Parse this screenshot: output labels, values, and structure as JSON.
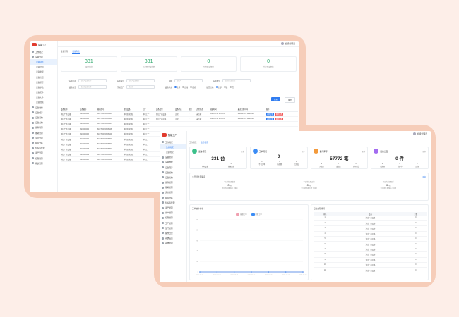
{
  "brand": "智能工厂",
  "user": "超级管理员",
  "window1": {
    "menu": [
      {
        "label": "工作概况",
        "type": "item"
      },
      {
        "label": "设备管理",
        "type": "item"
      },
      {
        "label": "设备列表",
        "type": "sub",
        "active": true
      },
      {
        "label": "设备分组",
        "type": "sub"
      },
      {
        "label": "设备类型",
        "type": "sub"
      },
      {
        "label": "设备位置",
        "type": "sub"
      },
      {
        "label": "设备型号",
        "type": "sub"
      },
      {
        "label": "设备参数",
        "type": "sub"
      },
      {
        "label": "设备配件",
        "type": "sub"
      },
      {
        "label": "设备文件",
        "type": "sub"
      },
      {
        "label": "设备档案",
        "type": "sub"
      },
      {
        "label": "设备维修",
        "type": "item"
      },
      {
        "label": "设备保养",
        "type": "item"
      },
      {
        "label": "设备巡检",
        "type": "item"
      },
      {
        "label": "设备点检",
        "type": "item"
      },
      {
        "label": "备件管理",
        "type": "item"
      },
      {
        "label": "能耗管理",
        "type": "item"
      },
      {
        "label": "安全管理",
        "type": "item"
      },
      {
        "label": "报表分析",
        "type": "item"
      },
      {
        "label": "知识库管理",
        "type": "item"
      },
      {
        "label": "资产管理",
        "type": "item"
      },
      {
        "label": "权限管理",
        "type": "item"
      },
      {
        "label": "系统管理",
        "type": "item"
      }
    ],
    "crumbs": [
      "设备管理",
      "设备列表"
    ],
    "stats": [
      {
        "value": "331",
        "label": "设备总数"
      },
      {
        "value": "331",
        "label": "已分配到设备数"
      },
      {
        "value": "0",
        "label": "已报废设备数"
      },
      {
        "value": "0",
        "label": "待维修设备数"
      }
    ],
    "form": {
      "rows": [
        [
          {
            "label": "设备名称",
            "ph": "请输入设备名称"
          },
          {
            "label": "设备编号",
            "ph": "请输入设备编号"
          },
          {
            "label": "规格",
            "ph": "请输入"
          },
          {
            "label": "设备类型",
            "ph": "请选择设备类型"
          }
        ],
        [
          {
            "label": "设备位置",
            "ph": "请选择设备位置"
          },
          {
            "label": "所属工厂",
            "ph": "请选择"
          }
        ]
      ],
      "status_label": "设备状态",
      "status_options": [
        "全部",
        "正常",
        "报修"
      ],
      "check_label": "是否点检",
      "check_options": [
        "全部",
        "是",
        "否"
      ]
    },
    "btn_search": "搜索",
    "btn_reset": "重置",
    "table": {
      "headers": [
        "设备名称",
        "设备编号",
        "规格型号",
        "所属设备",
        "工厂",
        "设备类型",
        "设备状态",
        "数量",
        "点检状态",
        "创建时间",
        "最近更新时间",
        "操作"
      ],
      "rows": [
        [
          "测试厂商设备",
          "XSG000001",
          "SC7700070908445",
          "本地区管理员",
          "本地工厂",
          "测试厂商设备",
          "正常",
          "1",
          "未点检",
          "2020-10-11 10:00:00",
          "2024-07-07 10:00:00"
        ],
        [
          "测试厂商设备",
          "XSG000002",
          "SC7700070908446",
          "本地区管理员",
          "本地工厂",
          "测试厂商设备",
          "正常",
          "1",
          "未点检",
          "2020-10-11 10:00:00",
          "2024-07-07 10:00:00"
        ],
        [
          "测试厂商设备",
          "XSG000003",
          "SC7700070908447",
          "本地区管理员",
          "本地工厂",
          "",
          "",
          "",
          "",
          "",
          ""
        ],
        [
          "测试厂商设备",
          "XSG000004",
          "SC7700070908448",
          "本地区管理员",
          "本地工厂",
          "",
          "",
          "",
          "",
          "",
          ""
        ],
        [
          "测试厂商设备",
          "XSG000005",
          "SC7700070908449",
          "本地区管理员",
          "本地工厂",
          "",
          "",
          "",
          "",
          "",
          ""
        ],
        [
          "测试厂商设备",
          "XSG000006",
          "SC7700070908450",
          "本地区管理员",
          "本地工厂",
          "",
          "",
          "",
          "",
          "",
          ""
        ],
        [
          "测试厂商设备",
          "XSG000007",
          "SC7700070908451",
          "本地区管理员",
          "本地工厂",
          "",
          "",
          "",
          "",
          "",
          ""
        ],
        [
          "测试厂商设备",
          "XSG000008",
          "SC7700070908452",
          "本地区管理员",
          "本地工厂",
          "",
          "",
          "",
          "",
          "",
          ""
        ],
        [
          "测试厂商设备",
          "XSG000009",
          "SC7700070908453",
          "本地区管理员",
          "本地工厂",
          "",
          "",
          "",
          "",
          "",
          ""
        ],
        [
          "测试厂商设备",
          "XSG000010",
          "SC7700070908454",
          "本地区管理员",
          "本地工厂",
          "",
          "",
          "",
          "",
          "",
          ""
        ]
      ],
      "op_edit": "编辑设备",
      "op_del": "删除设备"
    }
  },
  "window2": {
    "menu": [
      {
        "label": "工作概况",
        "type": "item"
      },
      {
        "label": "监控概况",
        "type": "sub",
        "active": true
      },
      {
        "label": "设备概况",
        "type": "sub"
      },
      {
        "label": "设备管理",
        "type": "item"
      },
      {
        "label": "设备维修",
        "type": "item"
      },
      {
        "label": "设备保养",
        "type": "item"
      },
      {
        "label": "设备巡检",
        "type": "item"
      },
      {
        "label": "设备点检",
        "type": "item"
      },
      {
        "label": "备件管理",
        "type": "item"
      },
      {
        "label": "能耗管理",
        "type": "item"
      },
      {
        "label": "安全管理",
        "type": "item"
      },
      {
        "label": "报表分析",
        "type": "item"
      },
      {
        "label": "知识库管理",
        "type": "item"
      },
      {
        "label": "资产管理",
        "type": "item"
      },
      {
        "label": "用户管理",
        "type": "item"
      },
      {
        "label": "权限管理",
        "type": "item"
      },
      {
        "label": "工厂管理",
        "type": "item"
      },
      {
        "label": "部门管理",
        "type": "item"
      },
      {
        "label": "操作日志",
        "type": "item"
      },
      {
        "label": "系统设置",
        "type": "item"
      },
      {
        "label": "系统管理",
        "type": "item"
      }
    ],
    "crumbs": [
      "工作概况",
      "监控概况"
    ],
    "kpis": [
      {
        "title": "设备概况",
        "more": "更多",
        "value": "331 台",
        "color": "#3cc08a",
        "sub": [
          {
            "v": "0",
            "l": "停机设备"
          },
          {
            "v": "0",
            "l": "故障设备"
          }
        ]
      },
      {
        "title": "工单概况",
        "more": "更多",
        "value": "0",
        "color": "#3b8cf5",
        "sub": [
          {
            "v": "0",
            "l": "今日工单"
          },
          {
            "v": "0",
            "l": "待处理"
          },
          {
            "v": "0",
            "l": "已完成"
          }
        ]
      },
      {
        "title": "备件库存",
        "more": "更多",
        "value": "57772 笔",
        "color": "#f39a3c",
        "sub": [
          {
            "v": "0",
            "l": "入库数"
          },
          {
            "v": "0",
            "l": "出库数"
          },
          {
            "v": "0",
            "l": "库存预警"
          }
        ]
      },
      {
        "title": "设备告警",
        "more": "更多",
        "value": "0 件",
        "color": "#a36cf0",
        "sub": [
          {
            "v": "0",
            "l": "未处理"
          },
          {
            "v": "0",
            "l": "处理中"
          },
          {
            "v": "0",
            "l": "已处理"
          }
        ]
      }
    ],
    "todo_title": "今日待处理事项",
    "todo_more": "更多",
    "todo": [
      {
        "label": "今日待处理维修",
        "value": "0",
        "unit": "项",
        "foot": "今日待处理维修 共0项"
      },
      {
        "label": "今日待处理点检",
        "value": "0",
        "unit": "项",
        "foot": "今日待处理点检 共0项"
      },
      {
        "label": "今日待处理保养",
        "value": "0",
        "unit": "项",
        "foot": "今日待处理保养 共0项"
      }
    ],
    "chart_title": "工单统计分析",
    "rank_title": "设备故障排行",
    "rank_headers": [
      "排名",
      "设备",
      "次数"
    ],
    "rank_rows": [
      [
        "1",
        "测试厂商设备",
        "0"
      ],
      [
        "2",
        "测试厂商设备",
        "0"
      ],
      [
        "3",
        "测试厂商设备",
        "0"
      ],
      [
        "4",
        "测试厂商设备",
        "0"
      ],
      [
        "5",
        "测试厂商设备",
        "0"
      ],
      [
        "6",
        "测试厂商设备",
        "0"
      ],
      [
        "7",
        "测试厂商设备",
        "0"
      ],
      [
        "8",
        "测试厂商设备",
        "0"
      ],
      [
        "9",
        "测试厂商设备",
        "0"
      ],
      [
        "10",
        "测试厂商设备",
        "0"
      ],
      [
        "11",
        "测试厂商设备",
        "0"
      ]
    ]
  },
  "chart_data": {
    "type": "line",
    "title": "工单统计分析",
    "x": [
      "2020-12-01",
      "2020-12-02",
      "2020-12-03",
      "2020-12-04",
      "2020-12-05",
      "2020-12-06",
      "2020-12-07"
    ],
    "series": [
      {
        "name": "报修工单",
        "values": [
          0,
          0,
          0,
          0,
          0,
          0,
          0
        ]
      },
      {
        "name": "保养工单",
        "values": [
          0,
          0,
          0,
          0,
          0,
          0,
          0
        ]
      }
    ],
    "ylim": [
      0,
      100
    ],
    "yticks": [
      "100",
      "80",
      "60",
      "40",
      "20",
      "0"
    ],
    "colors": [
      "#f0a0b0",
      "#3b8cf5"
    ]
  },
  "colors": {
    "accent": "#2f7cf0",
    "green": "#2ca86b",
    "danger": "#f15b5b"
  }
}
